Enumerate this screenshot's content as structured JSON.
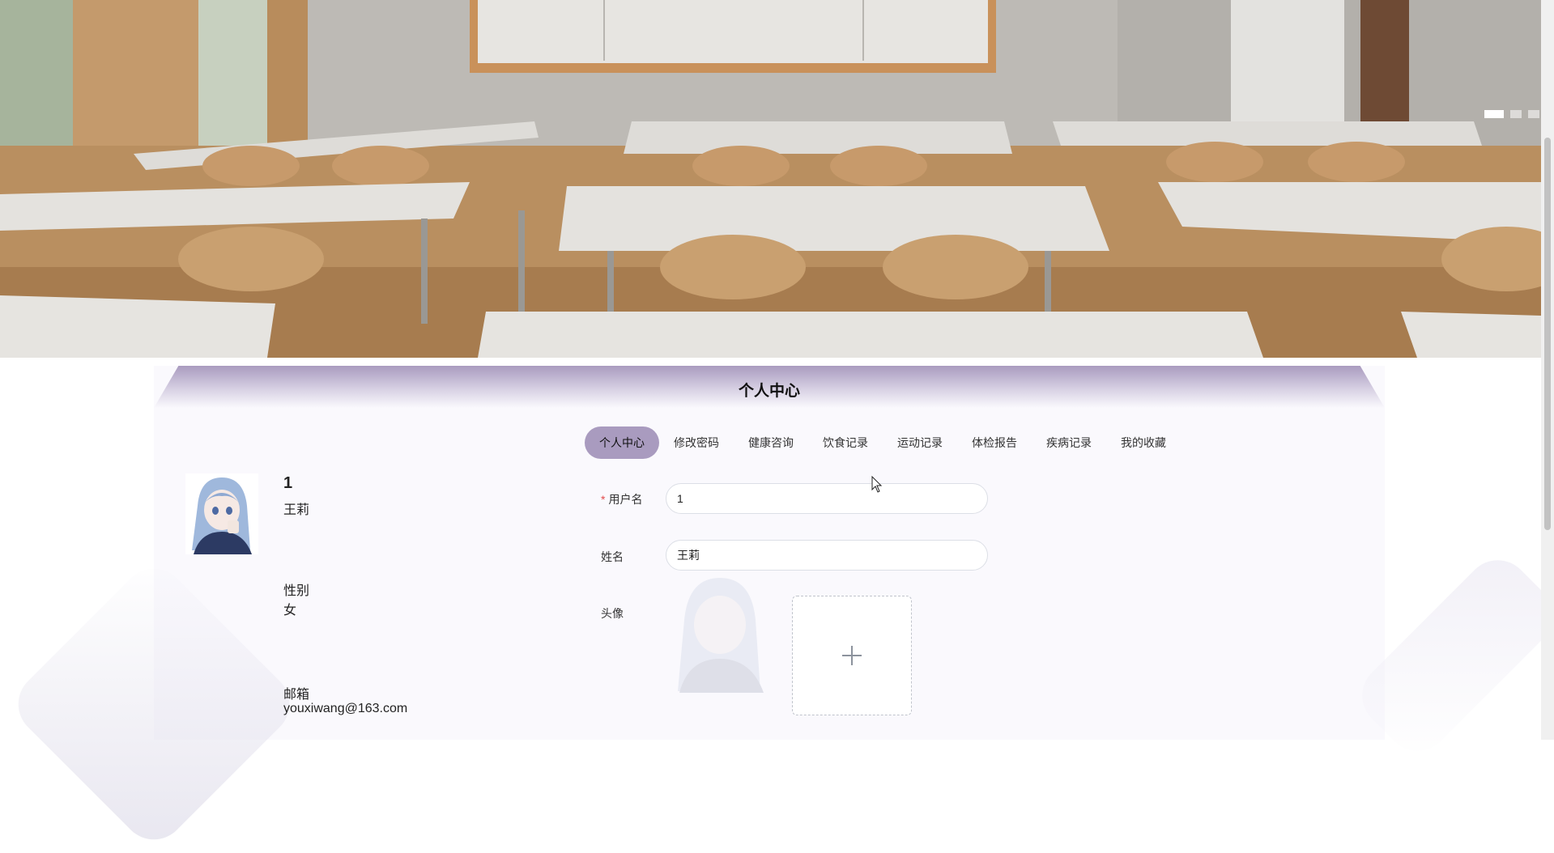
{
  "carousel": {
    "slides": 3,
    "active_index": 0
  },
  "page_title": "个人中心",
  "tabs": [
    {
      "label": "个人中心",
      "active": true
    },
    {
      "label": "修改密码",
      "active": false
    },
    {
      "label": "健康咨询",
      "active": false
    },
    {
      "label": "饮食记录",
      "active": false
    },
    {
      "label": "运动记录",
      "active": false
    },
    {
      "label": "体检报告",
      "active": false
    },
    {
      "label": "疾病记录",
      "active": false
    },
    {
      "label": "我的收藏",
      "active": false
    }
  ],
  "profile": {
    "username": "1",
    "name": "王莉",
    "gender_label": "性别",
    "gender": "女",
    "email_label": "邮箱",
    "email": "youxiwang@163.com"
  },
  "form": {
    "username_label": "用户名",
    "username_required_mark": "*",
    "username_value": "1",
    "name_label": "姓名",
    "name_value": "王莉",
    "avatar_label": "头像"
  },
  "icons": {
    "upload": "plus-icon",
    "cursor": "mouse-pointer-icon"
  },
  "colors": {
    "accent": "#a99bbf",
    "required": "#e24a4a",
    "panel_bg": "#faf9fd"
  }
}
